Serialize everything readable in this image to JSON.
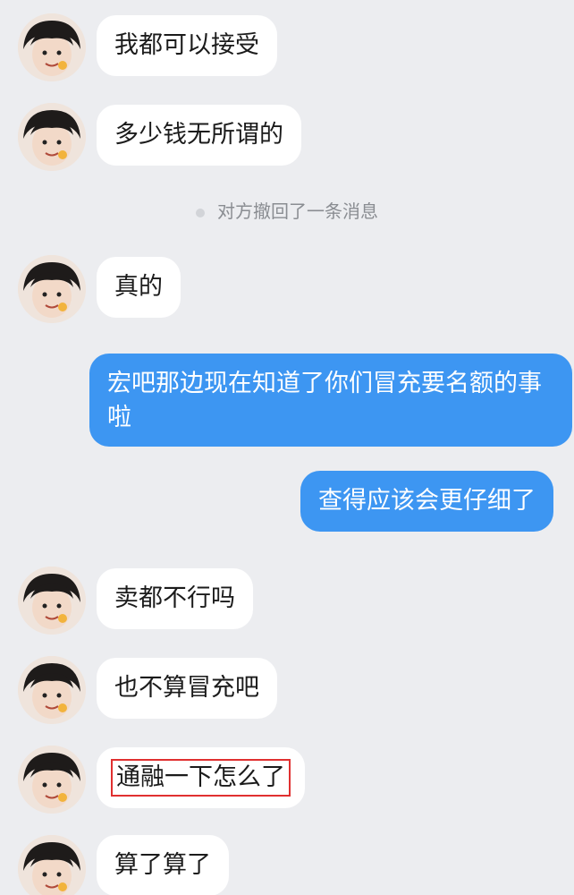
{
  "messages": [
    {
      "side": "in",
      "text": "我都可以接受"
    },
    {
      "side": "in",
      "text": "多少钱无所谓的"
    },
    {
      "side": "system",
      "text": "对方撤回了一条消息"
    },
    {
      "side": "in",
      "text": "真的"
    },
    {
      "side": "out",
      "text": "宏吧那边现在知道了你们冒充要名额的事啦"
    },
    {
      "side": "out",
      "text": "查得应该会更仔细了"
    },
    {
      "side": "in",
      "text": "卖都不行吗"
    },
    {
      "side": "in",
      "text": "也不算冒充吧"
    },
    {
      "side": "in",
      "text": "通融一下怎么了",
      "highlighted": true,
      "highlight_color": "#e03030"
    },
    {
      "side": "in",
      "text": "算了算了"
    }
  ],
  "colors": {
    "background": "#ecedf0",
    "incoming_bubble": "#ffffff",
    "outgoing_bubble": "#3d96f2"
  },
  "avatar": {
    "icon": "user-avatar-icon"
  }
}
